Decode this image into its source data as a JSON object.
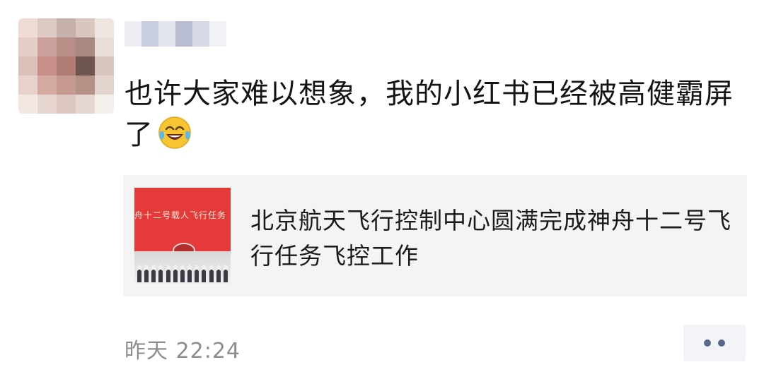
{
  "post": {
    "text": "也许大家难以想象，我的小红书已经被高健霸屏了",
    "emoji": "laughing-with-tears-emoji"
  },
  "link_card": {
    "thumbnail_banner": "舟十二号载人飞行任务",
    "title": "北京航天飞行控制中心圆满完成神舟十二号飞行任务飞控工作"
  },
  "footer": {
    "timestamp": "昨天 22:24",
    "more_icon": "more-dots-icon"
  },
  "colors": {
    "text": "#141414",
    "timestamp": "#8d8d8d",
    "card_bg": "#f4f4f4",
    "more_dots": "#58688c",
    "thumbnail_red": "#e43a3a"
  }
}
